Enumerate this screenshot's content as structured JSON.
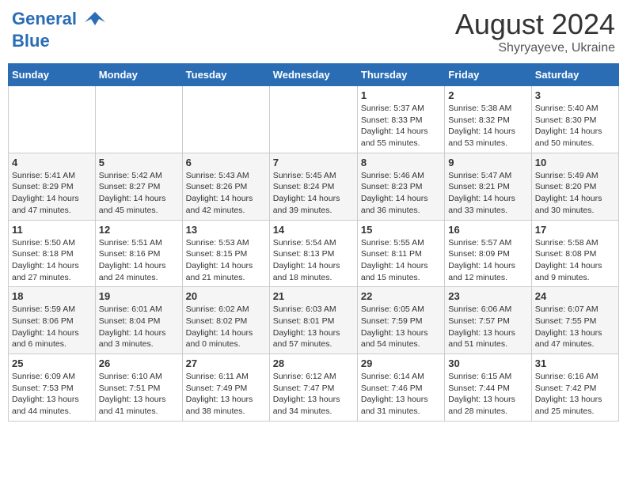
{
  "header": {
    "logo_line1": "General",
    "logo_line2": "Blue",
    "title": "August 2024",
    "location": "Shyryayeve, Ukraine"
  },
  "days_of_week": [
    "Sunday",
    "Monday",
    "Tuesday",
    "Wednesday",
    "Thursday",
    "Friday",
    "Saturday"
  ],
  "weeks": [
    [
      {
        "day": "",
        "info": ""
      },
      {
        "day": "",
        "info": ""
      },
      {
        "day": "",
        "info": ""
      },
      {
        "day": "",
        "info": ""
      },
      {
        "day": "1",
        "info": "Sunrise: 5:37 AM\nSunset: 8:33 PM\nDaylight: 14 hours and 55 minutes."
      },
      {
        "day": "2",
        "info": "Sunrise: 5:38 AM\nSunset: 8:32 PM\nDaylight: 14 hours and 53 minutes."
      },
      {
        "day": "3",
        "info": "Sunrise: 5:40 AM\nSunset: 8:30 PM\nDaylight: 14 hours and 50 minutes."
      }
    ],
    [
      {
        "day": "4",
        "info": "Sunrise: 5:41 AM\nSunset: 8:29 PM\nDaylight: 14 hours and 47 minutes."
      },
      {
        "day": "5",
        "info": "Sunrise: 5:42 AM\nSunset: 8:27 PM\nDaylight: 14 hours and 45 minutes."
      },
      {
        "day": "6",
        "info": "Sunrise: 5:43 AM\nSunset: 8:26 PM\nDaylight: 14 hours and 42 minutes."
      },
      {
        "day": "7",
        "info": "Sunrise: 5:45 AM\nSunset: 8:24 PM\nDaylight: 14 hours and 39 minutes."
      },
      {
        "day": "8",
        "info": "Sunrise: 5:46 AM\nSunset: 8:23 PM\nDaylight: 14 hours and 36 minutes."
      },
      {
        "day": "9",
        "info": "Sunrise: 5:47 AM\nSunset: 8:21 PM\nDaylight: 14 hours and 33 minutes."
      },
      {
        "day": "10",
        "info": "Sunrise: 5:49 AM\nSunset: 8:20 PM\nDaylight: 14 hours and 30 minutes."
      }
    ],
    [
      {
        "day": "11",
        "info": "Sunrise: 5:50 AM\nSunset: 8:18 PM\nDaylight: 14 hours and 27 minutes."
      },
      {
        "day": "12",
        "info": "Sunrise: 5:51 AM\nSunset: 8:16 PM\nDaylight: 14 hours and 24 minutes."
      },
      {
        "day": "13",
        "info": "Sunrise: 5:53 AM\nSunset: 8:15 PM\nDaylight: 14 hours and 21 minutes."
      },
      {
        "day": "14",
        "info": "Sunrise: 5:54 AM\nSunset: 8:13 PM\nDaylight: 14 hours and 18 minutes."
      },
      {
        "day": "15",
        "info": "Sunrise: 5:55 AM\nSunset: 8:11 PM\nDaylight: 14 hours and 15 minutes."
      },
      {
        "day": "16",
        "info": "Sunrise: 5:57 AM\nSunset: 8:09 PM\nDaylight: 14 hours and 12 minutes."
      },
      {
        "day": "17",
        "info": "Sunrise: 5:58 AM\nSunset: 8:08 PM\nDaylight: 14 hours and 9 minutes."
      }
    ],
    [
      {
        "day": "18",
        "info": "Sunrise: 5:59 AM\nSunset: 8:06 PM\nDaylight: 14 hours and 6 minutes."
      },
      {
        "day": "19",
        "info": "Sunrise: 6:01 AM\nSunset: 8:04 PM\nDaylight: 14 hours and 3 minutes."
      },
      {
        "day": "20",
        "info": "Sunrise: 6:02 AM\nSunset: 8:02 PM\nDaylight: 14 hours and 0 minutes."
      },
      {
        "day": "21",
        "info": "Sunrise: 6:03 AM\nSunset: 8:01 PM\nDaylight: 13 hours and 57 minutes."
      },
      {
        "day": "22",
        "info": "Sunrise: 6:05 AM\nSunset: 7:59 PM\nDaylight: 13 hours and 54 minutes."
      },
      {
        "day": "23",
        "info": "Sunrise: 6:06 AM\nSunset: 7:57 PM\nDaylight: 13 hours and 51 minutes."
      },
      {
        "day": "24",
        "info": "Sunrise: 6:07 AM\nSunset: 7:55 PM\nDaylight: 13 hours and 47 minutes."
      }
    ],
    [
      {
        "day": "25",
        "info": "Sunrise: 6:09 AM\nSunset: 7:53 PM\nDaylight: 13 hours and 44 minutes."
      },
      {
        "day": "26",
        "info": "Sunrise: 6:10 AM\nSunset: 7:51 PM\nDaylight: 13 hours and 41 minutes."
      },
      {
        "day": "27",
        "info": "Sunrise: 6:11 AM\nSunset: 7:49 PM\nDaylight: 13 hours and 38 minutes."
      },
      {
        "day": "28",
        "info": "Sunrise: 6:12 AM\nSunset: 7:47 PM\nDaylight: 13 hours and 34 minutes."
      },
      {
        "day": "29",
        "info": "Sunrise: 6:14 AM\nSunset: 7:46 PM\nDaylight: 13 hours and 31 minutes."
      },
      {
        "day": "30",
        "info": "Sunrise: 6:15 AM\nSunset: 7:44 PM\nDaylight: 13 hours and 28 minutes."
      },
      {
        "day": "31",
        "info": "Sunrise: 6:16 AM\nSunset: 7:42 PM\nDaylight: 13 hours and 25 minutes."
      }
    ]
  ]
}
